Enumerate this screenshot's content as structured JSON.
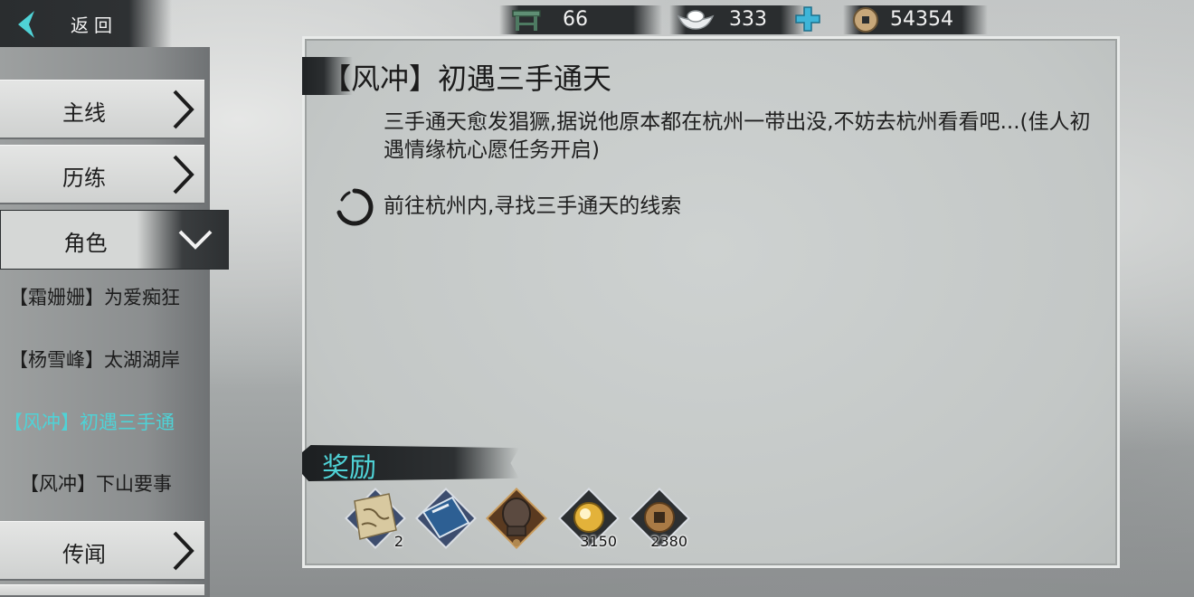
{
  "header": {
    "back_label": "返回",
    "stamina_value": "66",
    "silver_value": "333",
    "coin_value": "54354",
    "icons": [
      "back-arrow-icon",
      "bench-icon",
      "silver-ingot-icon",
      "plus-icon",
      "copper-coin-icon"
    ]
  },
  "sidebar": {
    "nav": [
      {
        "label": "主线"
      },
      {
        "label": "历练"
      },
      {
        "label": "角色"
      },
      {
        "label": "传闻"
      }
    ],
    "sub_items": [
      {
        "label": "【霜姗姗】为爱痴狂"
      },
      {
        "label": "【杨雪峰】太湖湖岸"
      },
      {
        "label": "【风冲】初遇三手通"
      },
      {
        "label": "【风冲】下山要事"
      }
    ]
  },
  "quest": {
    "title": "【风冲】初遇三手通天",
    "description": "三手通天愈发猖獗,据说他原本都在杭州一带出没,不妨去杭州看看吧...(佳人初遇情缘杭心愿任务开启)",
    "objective": "前往杭州内,寻找三手通天的线索"
  },
  "rewards": {
    "label": "奖励",
    "items": [
      {
        "icon": "map-scroll-icon",
        "count": "2"
      },
      {
        "icon": "book-icon",
        "count": ""
      },
      {
        "icon": "armor-icon",
        "count": ""
      },
      {
        "icon": "experience-orb-icon",
        "count": "3150"
      },
      {
        "icon": "copper-coin-icon",
        "count": "2380"
      }
    ]
  },
  "colors": {
    "accent_cyan": "#4fd2d6",
    "dark_brush": "#2b2e30",
    "panel_bg": "#c6cac9"
  }
}
